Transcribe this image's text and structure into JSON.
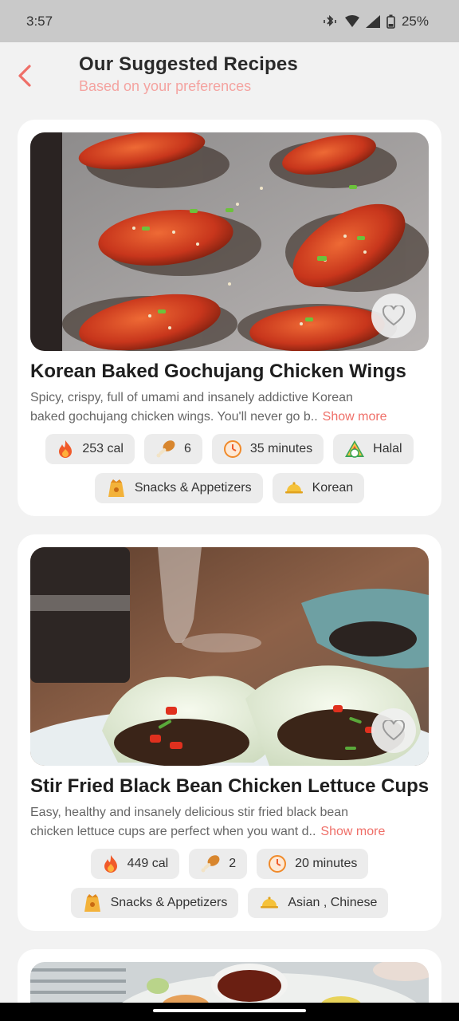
{
  "status_bar": {
    "time": "3:57",
    "battery": "25%"
  },
  "header": {
    "title": "Our Suggested Recipes",
    "subtitle": "Based on your preferences"
  },
  "recipes": [
    {
      "name": "Korean Baked Gochujang Chicken Wings",
      "desc_line1": "Spicy, crispy, full of umami and insanely addictive Korean",
      "desc_line2": "baked gochujang chicken wings. You'll never go b..",
      "show_more": "Show more",
      "calories": "253 cal",
      "ingredients": "6",
      "time": "35 minutes",
      "diet": "Halal",
      "category": "Snacks & Appetizers",
      "cuisine": "Korean"
    },
    {
      "name": "Stir Fried Black Bean Chicken Lettuce Cups",
      "desc_line1": "Easy, healthy and insanely delicious stir fried black bean",
      "desc_line2": "chicken lettuce cups are perfect when you want d..",
      "show_more": "Show more",
      "calories": "449 cal",
      "ingredients": "2",
      "time": "20 minutes",
      "category": "Snacks & Appetizers",
      "cuisine": "Asian , Chinese"
    }
  ],
  "icons": {
    "back": "chevron-left-icon",
    "favorite": "heart-outline-icon",
    "calories": "flame-icon",
    "ingredients": "drumstick-icon",
    "time": "timer-icon",
    "diet": "halal-badge-icon",
    "category": "snack-bag-icon",
    "cuisine": "dish-cover-icon"
  },
  "colors": {
    "accent": "#ef6f68",
    "subtitle": "#f4a3a0",
    "chip_bg": "#ececec",
    "card_bg": "#ffffff",
    "page_bg": "#f2f2f2"
  }
}
